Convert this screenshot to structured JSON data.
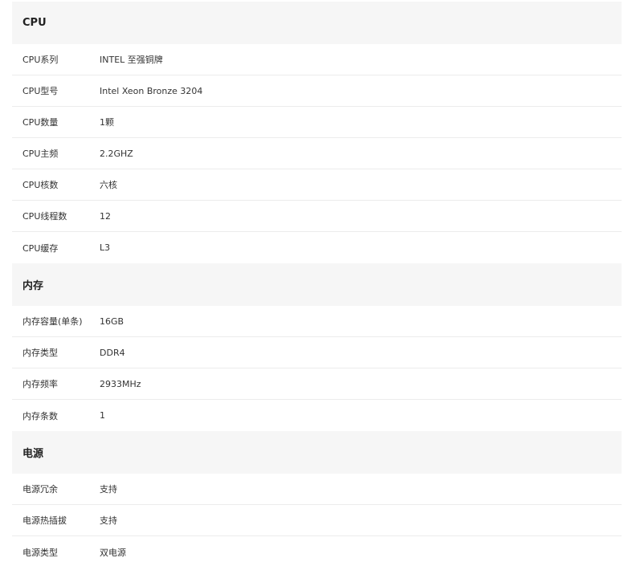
{
  "sections": [
    {
      "title": "CPU",
      "rows": [
        {
          "label": "CPU系列",
          "value": "INTEL 至强铜牌"
        },
        {
          "label": "CPU型号",
          "value": "Intel Xeon Bronze 3204"
        },
        {
          "label": "CPU数量",
          "value": "1颗"
        },
        {
          "label": "CPU主频",
          "value": "2.2GHZ"
        },
        {
          "label": "CPU核数",
          "value": "六核"
        },
        {
          "label": "CPU线程数",
          "value": "12"
        },
        {
          "label": "CPU缓存",
          "value": "L3"
        }
      ]
    },
    {
      "title": "内存",
      "rows": [
        {
          "label": "内存容量(单条)",
          "value": "16GB"
        },
        {
          "label": "内存类型",
          "value": "DDR4"
        },
        {
          "label": "内存频率",
          "value": "2933MHz"
        },
        {
          "label": "内存条数",
          "value": "1"
        }
      ]
    },
    {
      "title": "电源",
      "rows": [
        {
          "label": "电源冗余",
          "value": "支持"
        },
        {
          "label": "电源热插拔",
          "value": "支持"
        },
        {
          "label": "电源类型",
          "value": "双电源"
        }
      ]
    }
  ]
}
